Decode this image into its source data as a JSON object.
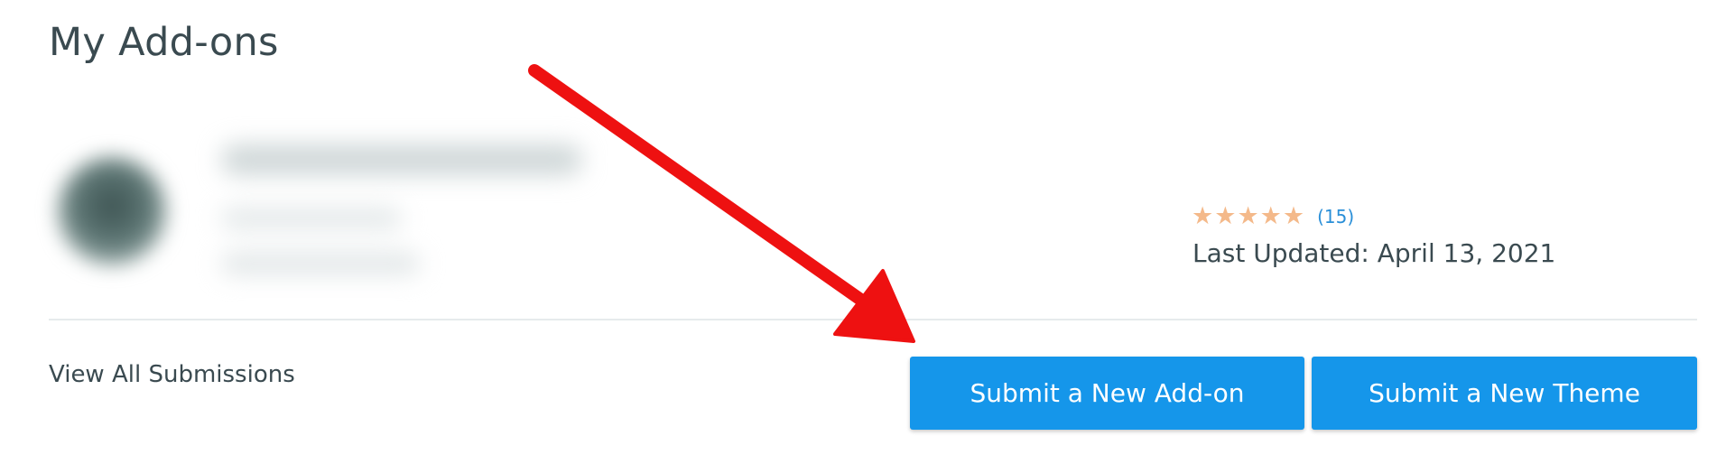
{
  "header": {
    "title": "My Add-ons"
  },
  "addon": {
    "icon": "addon-icon-blurred",
    "rating": {
      "stars": 5,
      "max_stars": 5,
      "star_glyph": "★",
      "count_label": "(15)"
    },
    "last_updated_label": "Last Updated: April 13, 2021"
  },
  "footer": {
    "view_all_label": "View All Submissions",
    "submit_addon_label": "Submit a New Add-on",
    "submit_theme_label": "Submit a New Theme"
  },
  "annotation": {
    "arrow_color": "#ee1111",
    "arrow_icon": "red-arrow-pointing-to-submit-addon"
  },
  "colors": {
    "primary_button": "#1596ea",
    "star": "#f4b98a",
    "link_blue": "#2a8fd8",
    "text_dark": "#3a4a50"
  }
}
